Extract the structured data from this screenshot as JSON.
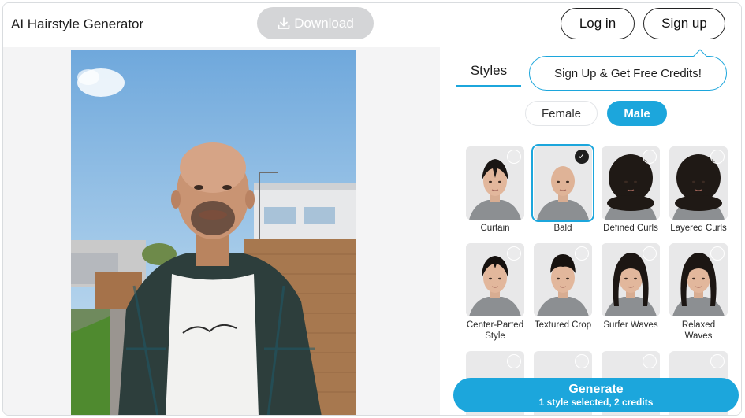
{
  "header": {
    "title": "AI Hairstyle Generator",
    "download_label": "Download",
    "login_label": "Log in",
    "signup_label": "Sign up"
  },
  "panel": {
    "tab_label": "Styles",
    "tooltip": "Sign Up & Get Free Credits!",
    "gender_female": "Female",
    "gender_male": "Male",
    "styles": [
      {
        "label": "Curtain",
        "selected": false,
        "hair": "curtain"
      },
      {
        "label": "Bald",
        "selected": true,
        "hair": "bald"
      },
      {
        "label": "Defined Curls",
        "selected": false,
        "hair": "curls"
      },
      {
        "label": "Layered Curls",
        "selected": false,
        "hair": "curls"
      },
      {
        "label": "Center-Parted Style",
        "selected": false,
        "hair": "center"
      },
      {
        "label": "Textured Crop",
        "selected": false,
        "hair": "crop"
      },
      {
        "label": "Surfer Waves",
        "selected": false,
        "hair": "waves"
      },
      {
        "label": "Relaxed Waves",
        "selected": false,
        "hair": "waves"
      }
    ],
    "generate_title": "Generate",
    "generate_sub": "1 style selected, 2 credits"
  },
  "colors": {
    "accent": "#1ca6dc",
    "download_disabled": "#d4d5d7",
    "canvas_bg": "#f4f4f5"
  },
  "icons": {
    "download": "download-icon",
    "selected_check": "check-icon"
  }
}
